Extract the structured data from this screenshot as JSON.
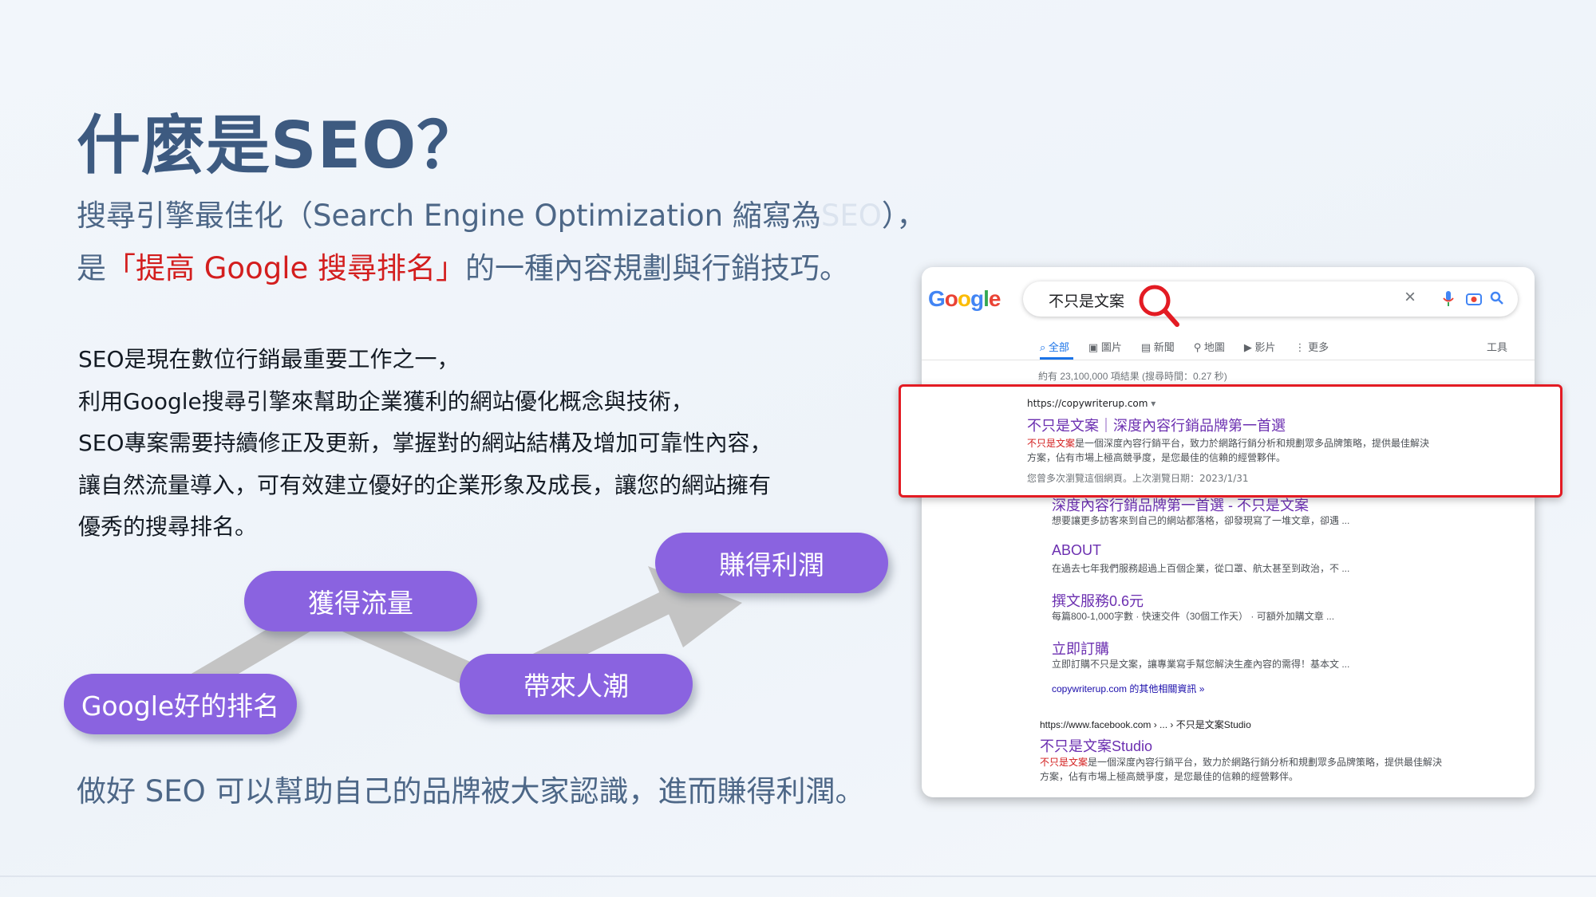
{
  "slide": {
    "title": "什麼是SEO？",
    "subtitle_line1_main": "搜尋引擎最佳化（Search Engine Optimization 縮寫為",
    "subtitle_line1_faded": "SEO",
    "subtitle_line1_end": "），",
    "subtitle_line2_pre": "是",
    "subtitle_line2_highlight": "「提高 Google 搜尋排名」",
    "subtitle_line2_post": "的一種內容規劃與行銷技巧。",
    "body": [
      "SEO是現在數位行銷最重要工作之一，",
      "利用Google搜尋引擎來幫助企業獲利的網站優化概念與技術，",
      "SEO專案需要持續修正及更新，掌握對的網站結構及增加可靠性內容，",
      "讓自然流量導入，可有效建立優好的企業形象及成長，讓您的網站擁有",
      "優秀的搜尋排名。"
    ],
    "conclusion": "做好 SEO 可以幫助自己的品牌被大家認識，進而賺得利潤。"
  },
  "diagram": {
    "steps": [
      "Google好的排名",
      "獲得流量",
      "帶來人潮",
      "賺得利潤"
    ],
    "pill_color": "#8a63e0",
    "arrow_color": "#c4c4c4"
  },
  "google": {
    "logo": "Google",
    "query": "不只是文案",
    "tabs": [
      "全部",
      "圖片",
      "新聞",
      "地圖",
      "影片",
      "更多"
    ],
    "tools": "工具",
    "result_count": "約有 23,100,000 項結果 (搜尋時間：0.27 秒)",
    "top_result": {
      "url": "https://copywriterup.com",
      "title": "不只是文案｜深度內容行銷品牌第一首選",
      "desc_em": "不只是文案",
      "desc_rest": "是一個深度內容行銷平台，致力於網路行銷分析和規劃眾多品牌策略，提供最佳解決",
      "desc_line2": "方案，佔有市場上極高競爭度，是您最佳的信賴的經營夥伴。",
      "visited": "您曾多次瀏覽這個網頁。上次瀏覽日期：2023/1/31"
    },
    "sitelinks": [
      {
        "title": "深度內容行銷品牌第一首選 - 不只是文案",
        "desc": "想要讓更多訪客來到自己的網站都落格，卻發現寫了一堆文章，卻遇 ..."
      },
      {
        "title": "ABOUT",
        "desc": "在過去七年我們服務超過上百個企業，從口罩、航太甚至到政治，不 ..."
      },
      {
        "title": "撰文服務0.6元",
        "desc": "每篇800-1,000字數 · 快速交件（30個工作天） · 可額外加購文章 ..."
      },
      {
        "title": "立即訂購",
        "desc": "立即訂購不只是文案，讓專業寫手幫您解決生產內容的需得！基本文 ..."
      }
    ],
    "more_results": "copywriterup.com 的其他相關資訊 »",
    "second_result": {
      "url": "https://www.facebook.com › ... › 不只是文案Studio",
      "title": "不只是文案Studio",
      "desc_em": "不只是文案",
      "desc_rest": "是一個深度內容行銷平台，致力於網路行銷分析和規劃眾多品牌策略，提供最佳解決",
      "desc_line2": "方案，佔有市場上極高競爭度，是您最佳的信賴的經營夥伴。"
    },
    "highlight_color": "#e31b23"
  }
}
